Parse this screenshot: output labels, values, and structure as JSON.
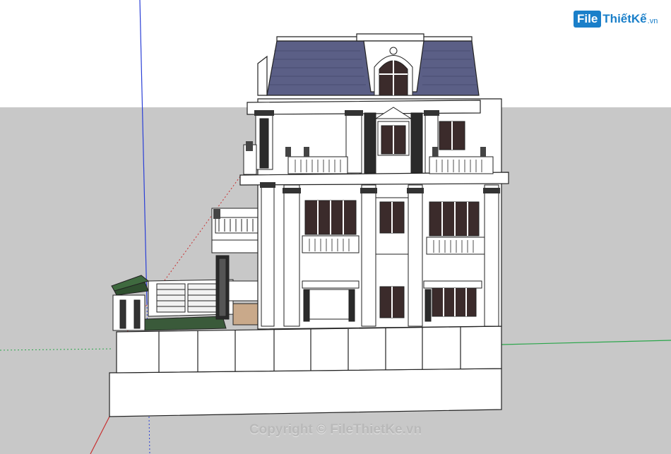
{
  "watermark": {
    "logo_badge": "File",
    "logo_name": "ThiếtKế",
    "logo_tld": ".vn",
    "copyright": "Copyright © FileThietKe.vn"
  },
  "colors": {
    "sky": "#ffffff",
    "ground": "#c8c8c8",
    "roof": "#5b5f86",
    "wall": "#ffffff",
    "axis_blue": "#2a3fd6",
    "axis_red": "#c83030",
    "axis_green": "#2aa64a",
    "brand": "#1a7fc9"
  }
}
